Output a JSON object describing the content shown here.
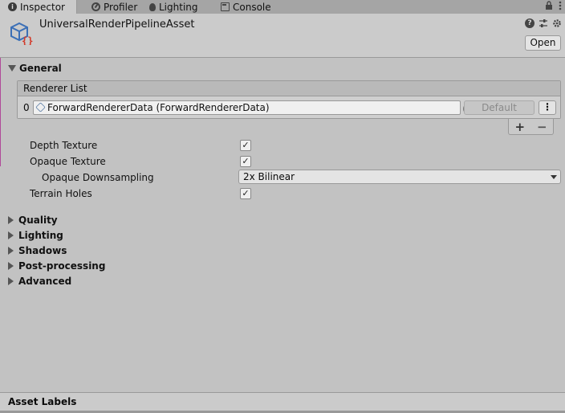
{
  "tabs": [
    {
      "label": "Inspector",
      "icon": "info-icon",
      "active": true
    },
    {
      "label": "Profiler",
      "icon": "profiler-icon"
    },
    {
      "label": "Lighting",
      "icon": "lightbulb-icon"
    },
    {
      "label": "Console",
      "icon": "console-icon"
    }
  ],
  "tabbar_icons": {
    "lock": "lock-icon",
    "menu": "kebab-menu-icon"
  },
  "header": {
    "title": "UniversalRenderPipelineAsset",
    "asset_icon": "render-pipeline-asset-icon",
    "icons": [
      "help-icon",
      "preset-icon",
      "settings-icon"
    ],
    "open_label": "Open"
  },
  "general": {
    "label": "General",
    "expanded": true,
    "renderer_list": {
      "header": "Renderer List",
      "rows": [
        {
          "index": "0",
          "value": "ForwardRendererData (ForwardRendererData)",
          "default_label": "Default"
        }
      ],
      "add_symbol": "+",
      "remove_symbol": "−"
    },
    "properties": {
      "depth_texture": {
        "label": "Depth Texture",
        "checked": true
      },
      "opaque_texture": {
        "label": "Opaque Texture",
        "checked": true
      },
      "opaque_downsampling": {
        "label": "Opaque Downsampling",
        "value": "2x Bilinear"
      },
      "terrain_holes": {
        "label": "Terrain Holes",
        "checked": true
      }
    }
  },
  "sections": [
    {
      "label": "Quality",
      "expanded": false
    },
    {
      "label": "Lighting",
      "expanded": false
    },
    {
      "label": "Shadows",
      "expanded": false
    },
    {
      "label": "Post-processing",
      "expanded": false
    },
    {
      "label": "Advanced",
      "expanded": false
    }
  ],
  "footer": {
    "asset_labels": "Asset Labels"
  },
  "colors": {
    "accent_blue": "#3b6fb6",
    "asset_icon_red": "#d23a2a",
    "object_icon": "#5e7fa7"
  }
}
